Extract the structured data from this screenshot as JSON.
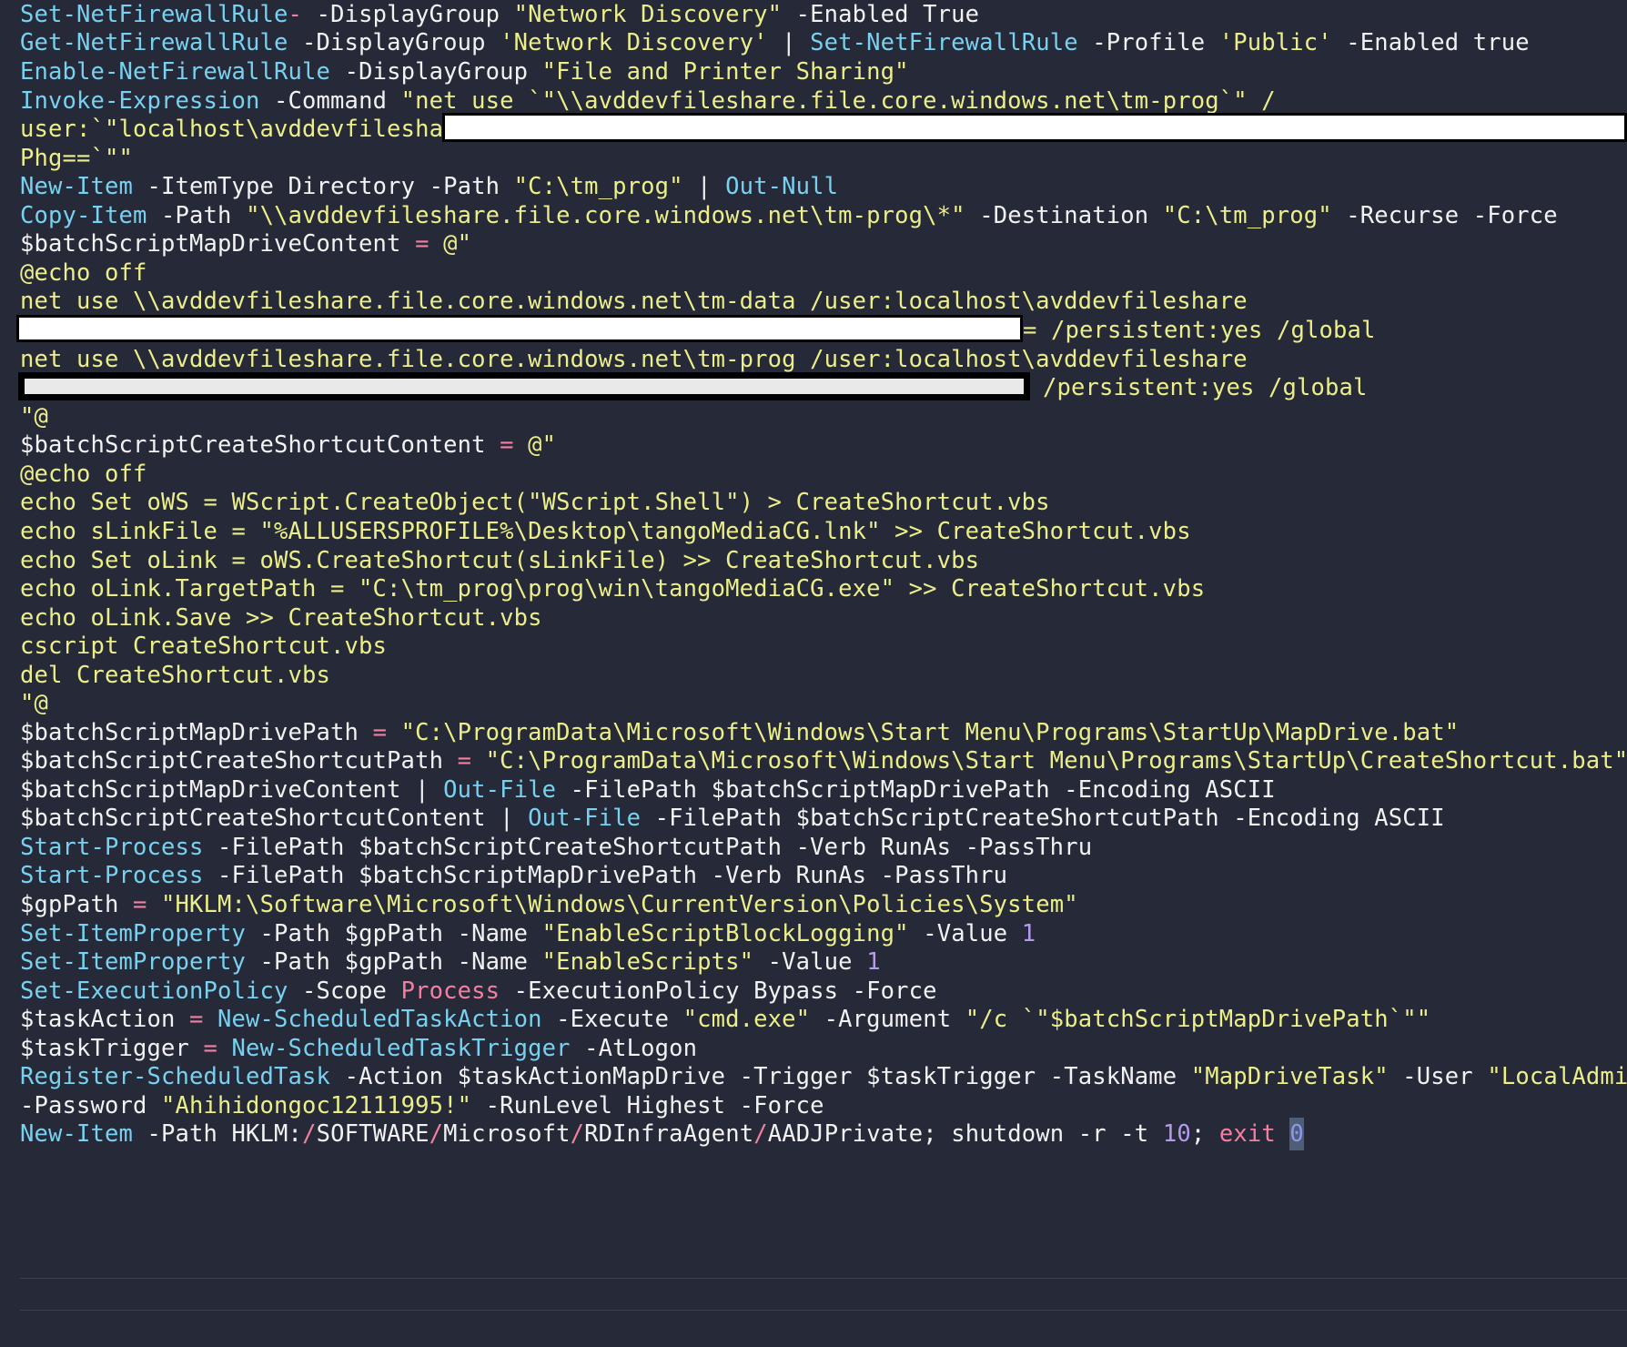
{
  "code_lines": [
    [
      "Set-NetFirewallRule",
      " -DisplayGroup ",
      "\"Network Discovery\"",
      " -Enabled True"
    ],
    [
      "Get-NetFirewallRule",
      " -DisplayGroup ",
      "'Network Discovery'",
      " | ",
      "Set-NetFirewallRule",
      " -Profile ",
      "'Public'",
      " -Enabled true"
    ],
    [
      "Enable-NetFirewallRule",
      " -DisplayGroup ",
      "\"File and Printer Sharing\""
    ],
    [
      "Invoke-Expression",
      " -Command ",
      "\"net use `\"\\\\avddevfileshare.file.core.windows.net\\tm-prog`\" /"
    ],
    [
      "user:`\"localhost\\avddevfileshare`\" `\""
    ],
    [
      "Phg==`\"\""
    ],
    [
      "New-Item",
      " -ItemType Directory ",
      "-Path ",
      "\"C:\\tm_prog\"",
      " | ",
      "Out-Null"
    ],
    [
      "Copy-Item",
      " -Path ",
      "\"\\\\avddevfileshare.file.core.windows.net\\tm-prog\\*\"",
      " -Destination ",
      "\"C:\\tm_prog\"",
      " -Recurse ",
      "-Force"
    ],
    [
      "$batchScriptMapDriveContent",
      " = ",
      "@\""
    ],
    [
      "@echo off"
    ],
    [
      "net use \\\\avddevfileshare.file.core.windows.net\\tm-data /user:localhost\\avddevfileshare"
    ],
    [
      "= /persistent:yes /global"
    ],
    [
      "net use \\\\avddevfileshare.file.core.windows.net\\tm-prog /user:localhost\\avddevfileshare"
    ],
    [
      "/persistent:yes /global"
    ],
    [
      "\"@"
    ],
    [
      "$batchScriptCreateShortcutContent",
      " = ",
      "@\""
    ],
    [
      "@echo off"
    ],
    [
      "echo Set oWS = WScript.CreateObject(\"WScript.Shell\") > CreateShortcut.vbs"
    ],
    [
      "echo sLinkFile = \"%ALLUSERSPROFILE%\\Desktop\\tangoMediaCG.lnk\" >> CreateShortcut.vbs"
    ],
    [
      "echo Set oLink = oWS.CreateShortcut(sLinkFile) >> CreateShortcut.vbs"
    ],
    [
      "echo oLink.TargetPath = \"C:\\tm_prog\\prog\\win\\tangoMediaCG.exe\" >> CreateShortcut.vbs"
    ],
    [
      "echo oLink.Save >> CreateShortcut.vbs"
    ],
    [
      "cscript CreateShortcut.vbs"
    ],
    [
      "del CreateShortcut.vbs"
    ],
    [
      "\"@"
    ],
    [
      "$batchScriptMapDrivePath",
      " = ",
      "\"C:\\ProgramData\\Microsoft\\Windows\\Start Menu\\Programs\\StartUp\\MapDrive.bat\""
    ],
    [
      "$batchScriptCreateShortcutPath",
      " = ",
      "\"C:\\ProgramData\\Microsoft\\Windows\\Start Menu\\Programs\\StartUp\\CreateShortcut.bat\""
    ],
    [
      "$batchScriptMapDriveContent | ",
      "Out-File",
      " -FilePath ",
      "$batchScriptMapDrivePath ",
      "-Encoding ASCII"
    ],
    [
      "$batchScriptCreateShortcutContent | ",
      "Out-File",
      " -FilePath ",
      "$batchScriptCreateShortcutPath ",
      "-Encoding ASCII"
    ],
    [
      "Start-Process",
      " -FilePath ",
      "$batchScriptCreateShortcutPath ",
      "-Verb RunAs ",
      "-PassThru"
    ],
    [
      "Start-Process",
      " -FilePath ",
      "$batchScriptMapDrivePath ",
      "-Verb RunAs ",
      "-PassThru"
    ],
    [
      "$gpPath",
      " = ",
      "\"HKLM:\\Software\\Microsoft\\Windows\\CurrentVersion\\Policies\\System\""
    ],
    [
      "Set-ItemProperty",
      " -Path ",
      "$gpPath ",
      "-Name ",
      "\"EnableScriptBlockLogging\"",
      " -Value ",
      "1"
    ],
    [
      "Set-ItemProperty",
      " -Path ",
      "$gpPath ",
      "-Name ",
      "\"EnableScripts\"",
      " -Value ",
      "1"
    ],
    [
      "Set-ExecutionPolicy",
      " -Scope ",
      "Process",
      " -ExecutionPolicy Bypass ",
      "-Force"
    ],
    [
      "$taskAction",
      " = ",
      "New-ScheduledTaskAction",
      " -Execute ",
      "\"cmd.exe\"",
      " -Argument ",
      "\"/c `\"$batchScriptMapDrivePath`\"\""
    ],
    [
      "$taskTrigger",
      " = ",
      "New-ScheduledTaskTrigger",
      " -AtLogon"
    ],
    [
      "Register-ScheduledTask",
      " -Action ",
      "$taskActionMapDrive ",
      "-Trigger ",
      "$taskTrigger ",
      "-TaskName ",
      "\"MapDriveTask\"",
      " -User ",
      "\"LocalAdmin\""
    ],
    [
      "-Password ",
      "\"Ahihidongoc12111995!\"",
      " -RunLevel Highest ",
      "-Force"
    ],
    [
      "New-Item",
      " -Path HKLM:",
      "/",
      "SOFTWARE",
      "/",
      "Microsoft",
      "/",
      "RDInfraAgent",
      "/",
      "AADJPrivate; shutdown ",
      "-r ",
      "-t ",
      "10",
      "; ",
      "exit ",
      "0"
    ]
  ],
  "colors": {
    "background": "#262a38",
    "cmdlet": "#78d1f0",
    "operator": "#f47fa0",
    "string": "#ecee8a",
    "number": "#b79af0",
    "text": "#f2f2f2"
  }
}
